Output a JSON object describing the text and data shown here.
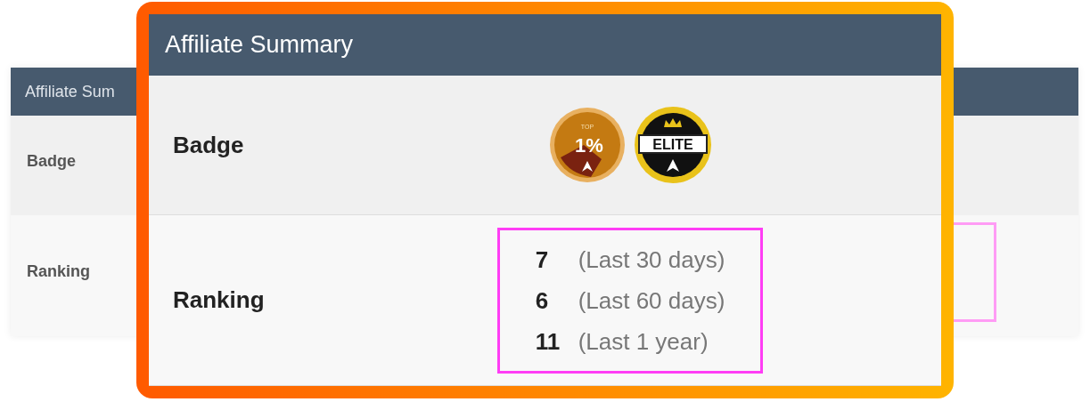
{
  "background_table": {
    "title": "Affiliate Sum",
    "rows": [
      {
        "label": "Badge"
      },
      {
        "label": "Ranking"
      }
    ]
  },
  "summary": {
    "title": "Affiliate Summary",
    "badge_row": {
      "label": "Badge",
      "badges": [
        {
          "kind": "top",
          "caption": "TOP",
          "text": "1%"
        },
        {
          "kind": "elite",
          "text": "ELITE"
        }
      ]
    },
    "ranking_row": {
      "label": "Ranking",
      "highlighted": true,
      "rankings": [
        {
          "rank": "7",
          "period": "(Last 30 days)"
        },
        {
          "rank": "6",
          "period": "(Last 60 days)"
        },
        {
          "rank": "11",
          "period": "(Last 1 year)"
        }
      ]
    }
  }
}
